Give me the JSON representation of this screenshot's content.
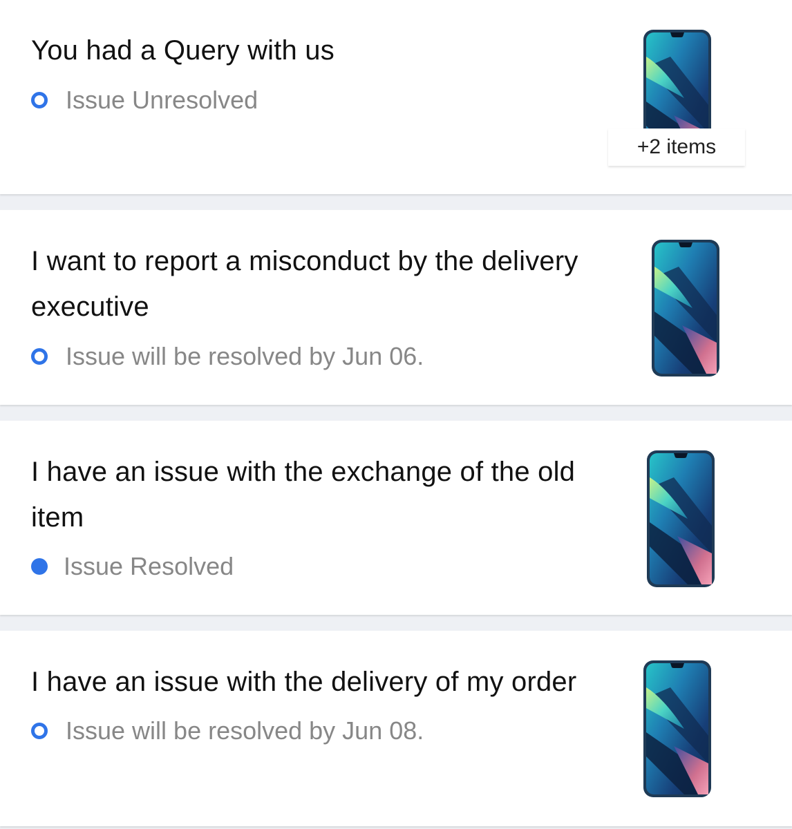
{
  "accent_color": "#2f74e8",
  "tickets": [
    {
      "title": "You had a Query with us",
      "status": "Issue Unresolved",
      "status_icon": "hollow-blue-circle-icon",
      "product_icon": "smartphone-thumbnail-icon",
      "extra_items_label": "+2 items"
    },
    {
      "title_line1": "I want to report a misconduct by the delivery",
      "title_line2": "executive",
      "status": "Issue will be resolved by Jun 06.",
      "status_icon": "hollow-blue-circle-icon",
      "product_icon": "smartphone-thumbnail-icon"
    },
    {
      "title_line1": "I have an issue with the exchange of the old",
      "title_line2": "item",
      "status": "Issue Resolved",
      "status_icon": "filled-blue-circle-icon",
      "product_icon": "smartphone-thumbnail-icon"
    },
    {
      "title": "I have an issue with the delivery of my order",
      "status": "Issue will be resolved by Jun 08.",
      "status_icon": "hollow-blue-circle-icon",
      "product_icon": "smartphone-thumbnail-icon"
    }
  ]
}
